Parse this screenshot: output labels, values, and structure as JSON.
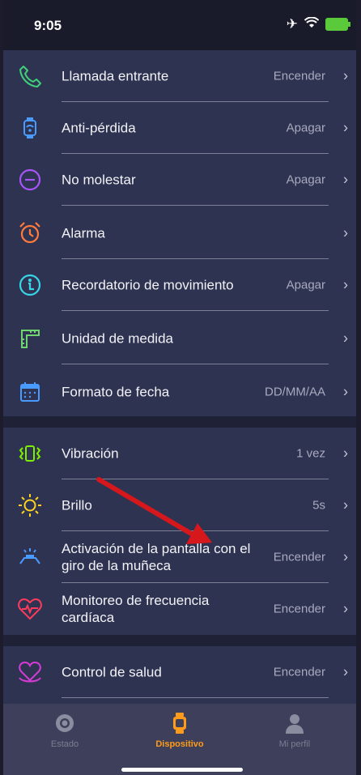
{
  "status": {
    "time": "9:05"
  },
  "settings": [
    {
      "label": "Llamada entrante",
      "value": "Encender",
      "icon": "phone-icon",
      "color": "#3fd17a"
    },
    {
      "label": "Anti-pérdida",
      "value": "Apagar",
      "icon": "watch-signal-icon",
      "color": "#4a9bff"
    },
    {
      "label": "No molestar",
      "value": "Apagar",
      "icon": "do-not-disturb-icon",
      "color": "#a855f7"
    },
    {
      "label": "Alarma",
      "value": "",
      "icon": "alarm-clock-icon",
      "color": "#ff7a3d"
    },
    {
      "label": "Recordatorio de movimiento",
      "value": "Apagar",
      "icon": "movement-reminder-icon",
      "color": "#38d5e8"
    },
    {
      "label": "Unidad de medida",
      "value": "",
      "icon": "ruler-icon",
      "color": "#6fd66f"
    },
    {
      "label": "Formato de fecha",
      "value": "DD/MM/AA",
      "icon": "calendar-icon",
      "color": "#4a9bff"
    }
  ],
  "settings2": [
    {
      "label": "Vibración",
      "value": "1 vez",
      "icon": "vibration-icon",
      "color": "#7cf000"
    },
    {
      "label": "Brillo",
      "value": "5s",
      "icon": "brightness-icon",
      "color": "#ffd21e"
    },
    {
      "label": "Activación de la pantalla con el giro de la muñeca",
      "value": "Encender",
      "icon": "wrist-raise-icon",
      "color": "#4a9bff"
    },
    {
      "label": "Monitoreo de frecuencia cardíaca",
      "value": "Encender",
      "icon": "heart-rate-icon",
      "color": "#ff3b5c"
    }
  ],
  "settings3": [
    {
      "label": "Control de salud",
      "value": "Encender",
      "icon": "health-heart-icon",
      "color": "#d63bd6"
    }
  ],
  "tabs": [
    {
      "label": "Estado",
      "icon": "status-icon"
    },
    {
      "label": "Dispositivo",
      "icon": "device-watch-icon",
      "active": true
    },
    {
      "label": "Mi perfil",
      "icon": "profile-icon"
    }
  ],
  "colors": {
    "accent": "#ff9b1a",
    "background": "#2f3352",
    "annotation_arrow": "#d6171c"
  }
}
